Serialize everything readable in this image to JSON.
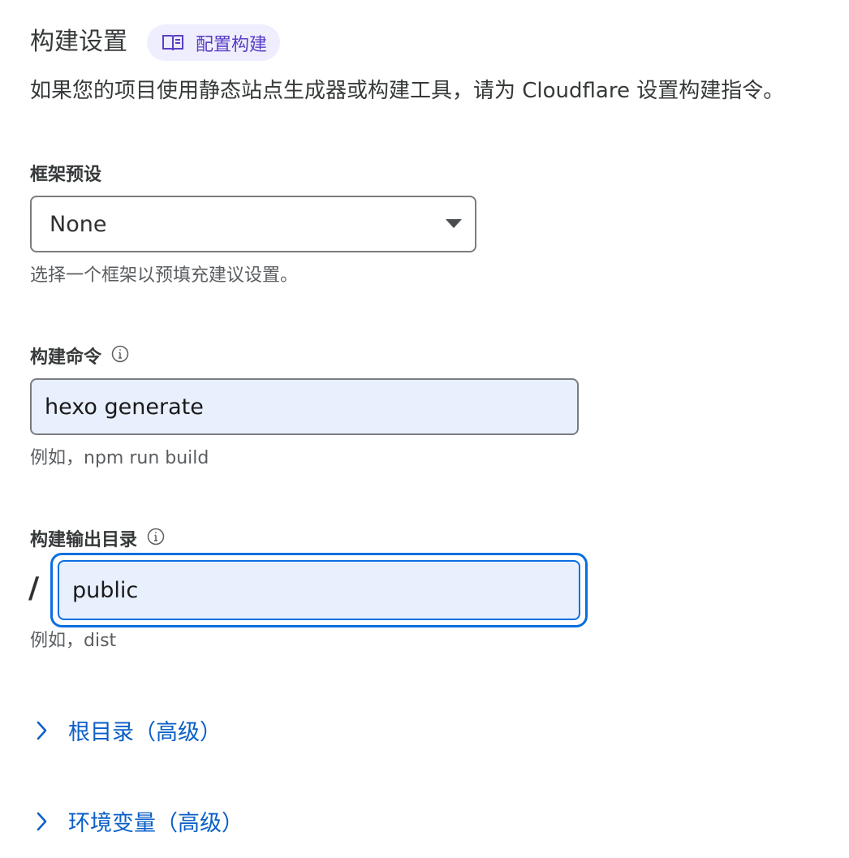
{
  "header": {
    "title": "构建设置",
    "docs_link_label": "配置构建",
    "description": "如果您的项目使用静态站点生成器或构建工具，请为 Cloudflare 设置构建指令。"
  },
  "framework_preset": {
    "label": "框架预设",
    "selected_value": "None",
    "helper": "选择一个框架以预填充建议设置。"
  },
  "build_command": {
    "label": "构建命令",
    "value": "hexo generate",
    "helper": "例如，npm run build"
  },
  "build_output_directory": {
    "label": "构建输出目录",
    "prefix": "/",
    "value": "public",
    "helper": "例如，dist"
  },
  "advanced_sections": {
    "root_directory": "根目录（高级）",
    "environment_variables": "环境变量（高级）"
  },
  "colors": {
    "accent_link": "#0b5fc7",
    "focus_ring": "#0a6fe0",
    "pill_background": "#efeefe",
    "pill_text": "#5a3fc5",
    "input_background": "#e8f0fe"
  },
  "icons": {
    "docs_link": "book-icon",
    "field_info": "info-icon",
    "expander": "chevron-right-icon",
    "select_caret": "caret-down-icon"
  }
}
